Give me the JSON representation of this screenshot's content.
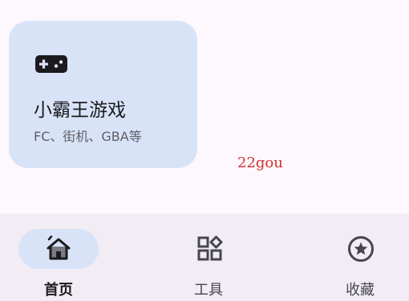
{
  "card": {
    "icon": "gamepad-icon",
    "title": "小霸王游戏",
    "subtitle": "FC、街机、GBA等"
  },
  "watermark": "22gou",
  "bottom_nav": {
    "items": [
      {
        "label": "首页",
        "icon": "home-icon",
        "selected": true
      },
      {
        "label": "工具",
        "icon": "widgets-icon",
        "selected": false
      },
      {
        "label": "收藏",
        "icon": "star-circle-icon",
        "selected": false
      }
    ]
  },
  "colors": {
    "background": "#fcf8fd",
    "card": "#d9e3f8",
    "nav_background": "#f2ecf4",
    "watermark": "#d0312d"
  }
}
